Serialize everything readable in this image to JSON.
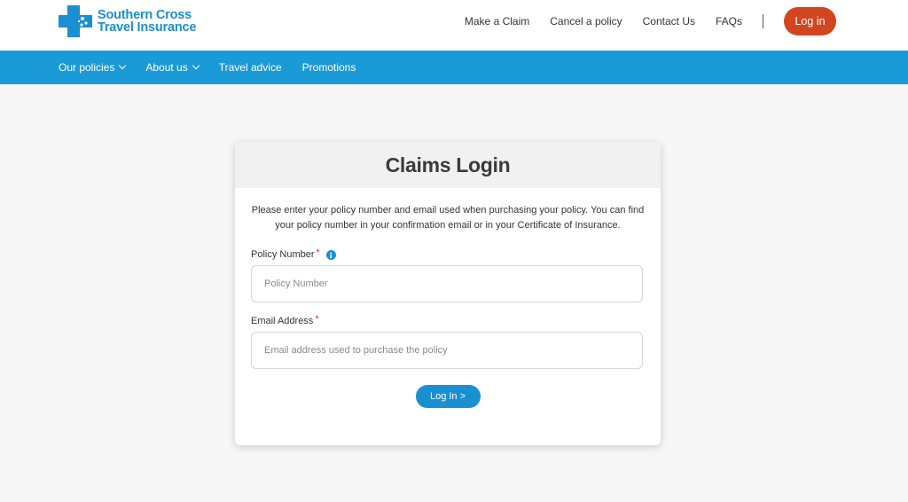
{
  "brand": {
    "line1": "Southern Cross",
    "line2": "Travel Insurance",
    "color": "#1a8fd1"
  },
  "top_nav": {
    "links": [
      "Make a Claim",
      "Cancel a policy",
      "Contact Us",
      "FAQs"
    ],
    "login_label": "Log in",
    "login_color": "#d2461f"
  },
  "main_nav": {
    "items": [
      {
        "label": "Our policies",
        "has_dropdown": true
      },
      {
        "label": "About us",
        "has_dropdown": true
      },
      {
        "label": "Travel advice",
        "has_dropdown": false
      },
      {
        "label": "Promotions",
        "has_dropdown": false
      }
    ],
    "background": "#1a9ad6"
  },
  "card": {
    "title": "Claims Login",
    "intro": "Please enter your policy number and email used when purchasing your policy. You can find your policy number in your confirmation email or in your Certificate of Insurance.",
    "policy_field": {
      "label": "Policy Number",
      "required_mark": "*",
      "info_icon": "info-icon",
      "value": "",
      "placeholder": "Policy Number"
    },
    "email_field": {
      "label": "Email Address",
      "required_mark": "*",
      "value": "",
      "placeholder": "Email address used to purchase the policy"
    },
    "submit_label": "Log In >"
  }
}
